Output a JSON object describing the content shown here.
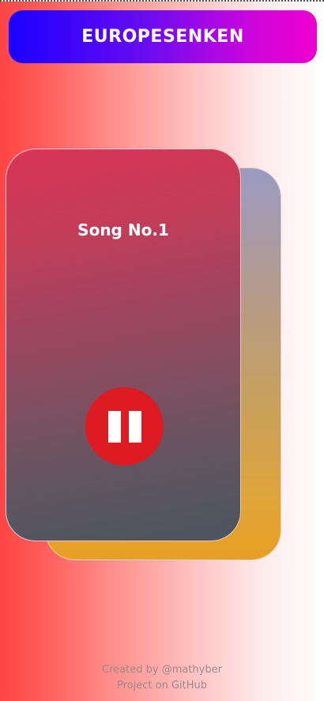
{
  "header": {
    "title": "EUROPESENKEN"
  },
  "player": {
    "song_title": "Song No.1",
    "play_state": "playing",
    "control_icon": "pause-icon"
  },
  "footer": {
    "created_by_prefix": "Created by ",
    "author": "@mathyber",
    "project_link": "Project on GitHub"
  },
  "colors": {
    "header_gradient_start": "#1a00ff",
    "header_gradient_end": "#ef00d1",
    "pause_button": "#de1b22",
    "card_front_top": "#da3458",
    "card_back_bottom": "#e8a023"
  }
}
